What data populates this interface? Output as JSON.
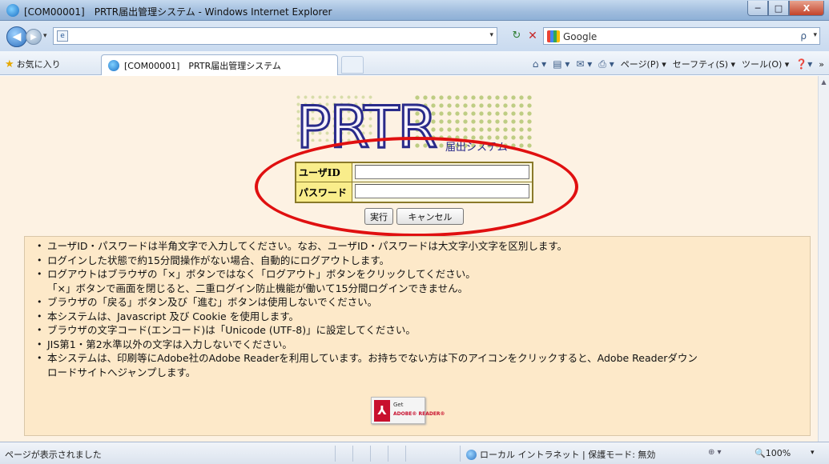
{
  "window": {
    "title": "[COM00001]　PRTR届出管理システム - Windows Internet Explorer",
    "min_glyph": "─",
    "max_glyph": "□",
    "close_glyph": "X"
  },
  "address": {
    "url": "",
    "search_engine": "Google",
    "search_glyph": "ρ",
    "page_glyph": "e",
    "refresh_glyph": "↻",
    "stop_glyph": "✕",
    "back_glyph": "◀",
    "forward_glyph": "▶"
  },
  "favorites": {
    "label": "お気に入り",
    "tab_title": "[COM00001]　PRTR届出管理システム",
    "commands": [
      "ページ(P) ▾",
      "セーフティ(S) ▾",
      "ツール(O) ▾"
    ],
    "home_glyph": "⌂ ▾",
    "feed_glyph": "▤ ▾",
    "mail_glyph": "✉ ▾",
    "print_glyph": "⎙ ▾",
    "help_glyph": "❓▾",
    "overflow_glyph": "»"
  },
  "logo": {
    "main": "PRTR",
    "sub": "届出システム"
  },
  "login": {
    "userid_label": "ユーザID",
    "userid_value": "",
    "password_label": "パスワード",
    "password_value": "",
    "execute_label": "実行",
    "cancel_label": "キャンセル"
  },
  "notes": [
    {
      "text": "ユーザID・パスワードは半角文字で入力してください。なお、ユーザID・パスワードは大文字小文字を区別します。",
      "bullet": true
    },
    {
      "text": "ログインした状態で約15分間操作がない場合、自動的にログアウトします。",
      "bullet": true
    },
    {
      "text": "ログアウトはブラウザの「×」ボタンではなく「ログアウト」ボタンをクリックしてください。",
      "bullet": true
    },
    {
      "text": "「×」ボタンで画面を閉じると、二重ログイン防止機能が働いて15分間ログインできません。",
      "bullet": false
    },
    {
      "text": "ブラウザの「戻る」ボタン及び「進む」ボタンは使用しないでください。",
      "bullet": true
    },
    {
      "text": "本システムは、Javascript 及び Cookie を使用します。",
      "bullet": true
    },
    {
      "text": "ブラウザの文字コード(エンコード)は「Unicode (UTF-8)」に設定してください。",
      "bullet": true
    },
    {
      "text": "JIS第1・第2水準以外の文字は入力しないでください。",
      "bullet": true
    },
    {
      "text": "本システムは、印刷等にAdobe社のAdobe Readerを利用しています。お持ちでない方は下のアイコンをクリックすると、Adobe Readerダウン\nロードサイトへジャンプします。",
      "bullet": true
    }
  ],
  "adobe": {
    "get": "Get",
    "reader": "ADOBE® READER®",
    "glyph": "⅄"
  },
  "status": {
    "message": "ページが表示されました",
    "zone": "ローカル イントラネット | 保護モード: 無効",
    "protected_glyph": "⊕ ▾",
    "zoom": "🔍100%",
    "zoom_dd": "▾"
  },
  "colors": {
    "content_bg": "#fdf2e3",
    "notes_bg": "#fde9c9",
    "label_bg": "#f9ed8b",
    "logo_ink": "#2a2b8a",
    "highlight": "#e01010"
  }
}
